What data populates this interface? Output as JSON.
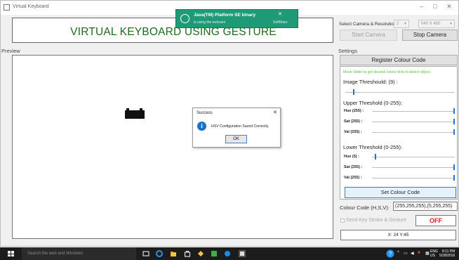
{
  "window": {
    "title": "Virtual Keyboard",
    "controls": {
      "minimize": "–",
      "maximize": "□",
      "close": "✕"
    }
  },
  "banner": {
    "title": "VIRTUAL KEYBOARD USING GESTURE"
  },
  "notification": {
    "title": "Java(TM) Platform SE binary",
    "subtitle": "is using the webcam",
    "close": "✕",
    "app": "SoftWare"
  },
  "preview": {
    "label": "Preview"
  },
  "dialog": {
    "title": "Success",
    "message": "HSV Configuration Saved Correctly.",
    "ok_label": "OK",
    "close": "✕",
    "icon": "info-icon"
  },
  "camera": {
    "select_label": "Select Camera & Resolution:",
    "camera_value": "2",
    "resolution_value": "640 X 480",
    "start_label": "Start Camera",
    "stop_label": "Stop Camera"
  },
  "settings": {
    "label": "Settings",
    "register_label": "Register Colour Code",
    "hint": "Move Slider to get desired colour blob to detect object.",
    "image_threshold_label": "Image Threshould: (9) :",
    "image_threshold_value": 9,
    "upper_label": "Upper Threshold (0-255):",
    "upper": [
      {
        "label": "Hue (255) :",
        "value": 255
      },
      {
        "label": "Sat (255) :",
        "value": 255
      },
      {
        "label": "Val (255) :",
        "value": 255
      }
    ],
    "lower_label": "Lower Threshold (0-255):",
    "lower": [
      {
        "label": "Hue (5) :",
        "value": 5
      },
      {
        "label": "Sat (255) :",
        "value": 255
      },
      {
        "label": "Val (255) :",
        "value": 255
      }
    ],
    "set_label": "Set Colour Code",
    "colour_code_label": "Colour Code (H,S,V):",
    "colour_code_value": "(255,255,255),(5,255,255)",
    "send_label": "Send Key Stroke & Gesture",
    "status": "OFF",
    "coords": "X: 24 Y:45"
  },
  "taskbar": {
    "search_placeholder": "Search the web and Windows",
    "tray_lang": "ENG",
    "tray_region": "US",
    "time": "8:11 PM",
    "date": "5/28/2016"
  },
  "colors": {
    "banner_text": "#1e6b1e",
    "hint": "#56c93a",
    "off": "#f01818",
    "slider": "#1f74d4",
    "toast": "#1f9a77"
  }
}
